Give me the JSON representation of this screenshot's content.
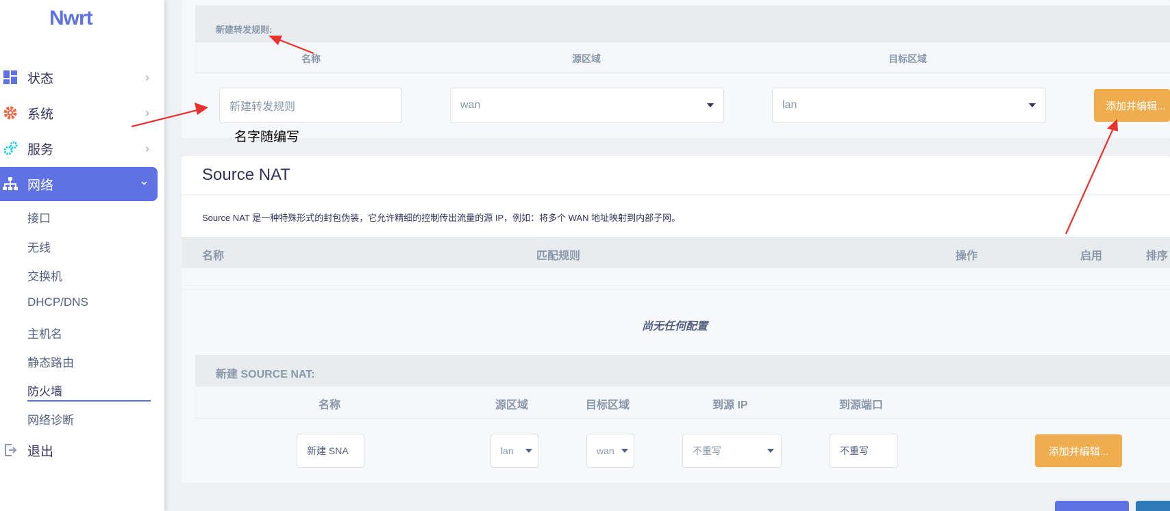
{
  "sidebar": {
    "logo": "Nwrt",
    "items": [
      {
        "label": "状态",
        "chevron": "›"
      },
      {
        "label": "系统",
        "chevron": "›"
      },
      {
        "label": "服务",
        "chevron": "›"
      },
      {
        "label": "网络",
        "chevron": "⌄"
      }
    ],
    "sub_items": [
      "接口",
      "无线",
      "交换机",
      "DHCP/DNS",
      "主机名",
      "静态路由",
      "防火墙",
      "网络诊断"
    ],
    "logout": "退出"
  },
  "forward_section": {
    "header": "新建转发规则:",
    "col_name": "名称",
    "col_src": "源区域",
    "col_dest": "目标区域",
    "name_placeholder": "新建转发规则",
    "src_value": "wan",
    "dest_value": "lan",
    "add_button": "添加并编辑..."
  },
  "annotation": "名字随编写",
  "snat": {
    "title": "Source NAT",
    "description": "Source NAT 是一种特殊形式的封包伪装，它允许精细的控制传出流量的源 IP，例如：将多个 WAN 地址映射到内部子网。",
    "columns": [
      "名称",
      "匹配规则",
      "操作",
      "启用",
      "排序"
    ],
    "empty": "尚无任何配置",
    "new_header": "新建 SOURCE NAT:",
    "new_cols": [
      "名称",
      "源区域",
      "目标区域",
      "到源 IP",
      "到源端口"
    ],
    "name_placeholder": "新建 SNA",
    "src_value": "lan",
    "dest_value": "wan",
    "ip_value": "不重写",
    "port_value": "不重写",
    "add_button": "添加并编辑..."
  },
  "colors": {
    "accent": "#5e72e4",
    "button": "#f0ad4e",
    "arrow": "#e8322e"
  }
}
